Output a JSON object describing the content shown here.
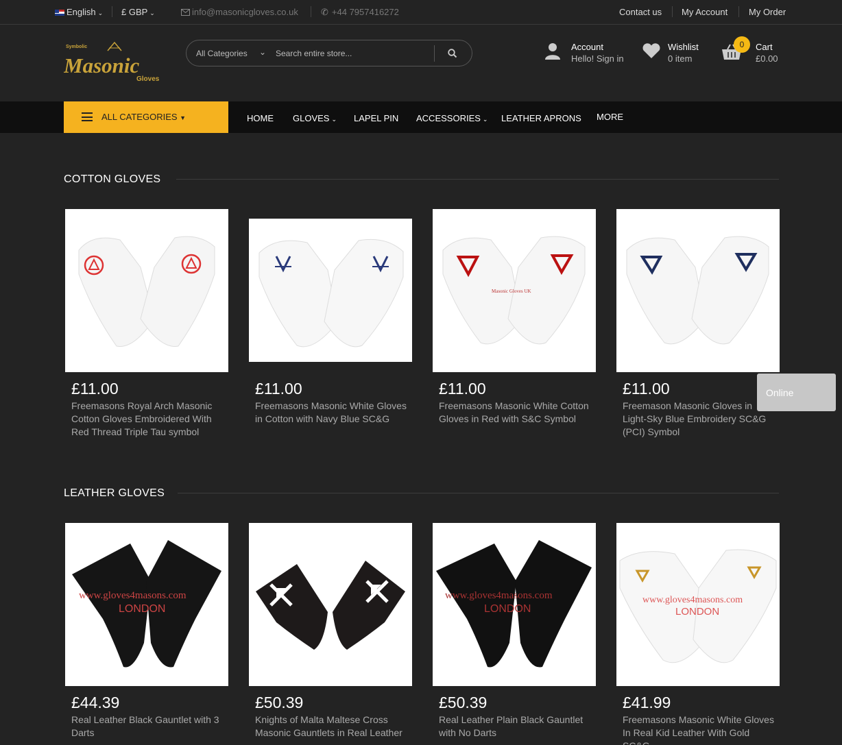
{
  "topbar": {
    "language": "English",
    "currency": "£ GBP",
    "email": "info@masonicgloves.co.uk",
    "phone": "+44 7957416272",
    "links": [
      "Contact us",
      "My Account",
      "My Order"
    ]
  },
  "logo": {
    "top": "Symbolic",
    "main": "Masonic",
    "sub": "Gloves"
  },
  "search": {
    "category": "All Categories",
    "placeholder": "Search entire store..."
  },
  "header": {
    "account_title": "Account",
    "account_sub": "Hello! Sign in",
    "wishlist_title": "Wishlist",
    "wishlist_sub": "0 item",
    "cart_title": "Cart",
    "cart_total": "£0.00",
    "cart_count": "0"
  },
  "nav": {
    "all_categories": "ALL CATEGORIES",
    "items": [
      "HOME",
      "GLOVES",
      "LAPEL PIN",
      "ACCESSORIES",
      "LEATHER APRONS",
      "MORE"
    ]
  },
  "sections": [
    {
      "title": "COTTON GLOVES",
      "products": [
        {
          "price": "£11.00",
          "name": "Freemasons Royal Arch Masonic Cotton Gloves Embroidered With Red Thread Triple Tau symbol"
        },
        {
          "price": "£11.00",
          "name": "Freemasons Masonic White Gloves in Cotton with Navy Blue SC&G"
        },
        {
          "price": "£11.00",
          "name": "Freemasons Masonic White Cotton Gloves in Red with S&C Symbol"
        },
        {
          "price": "£11.00",
          "name": "Freemason Masonic Gloves in Light-Sky Blue Embroidery SC&G (PCI) Symbol"
        }
      ]
    },
    {
      "title": "LEATHER GLOVES",
      "products": [
        {
          "price": "£44.39",
          "name": "Real Leather Black Gauntlet with 3 Darts"
        },
        {
          "price": "£50.39",
          "name": "Knights of Malta Maltese Cross Masonic Gauntlets in Real Leather"
        },
        {
          "price": "£50.39",
          "name": "Real Leather Plain Black Gauntlet with No Darts"
        },
        {
          "price": "£41.99",
          "name": "Freemasons Masonic White Gloves In Real Kid Leather With Gold SC&G"
        }
      ]
    }
  ],
  "watermarks": {
    "masonic_uk": "Masonic Gloves UK",
    "gloves_url": "www.gloves4masons.com",
    "london": "LONDON"
  },
  "chat": {
    "status": "Online"
  },
  "colors": {
    "accent": "#f5b21f",
    "background": "#232323",
    "nav": "#0f0f0f"
  }
}
